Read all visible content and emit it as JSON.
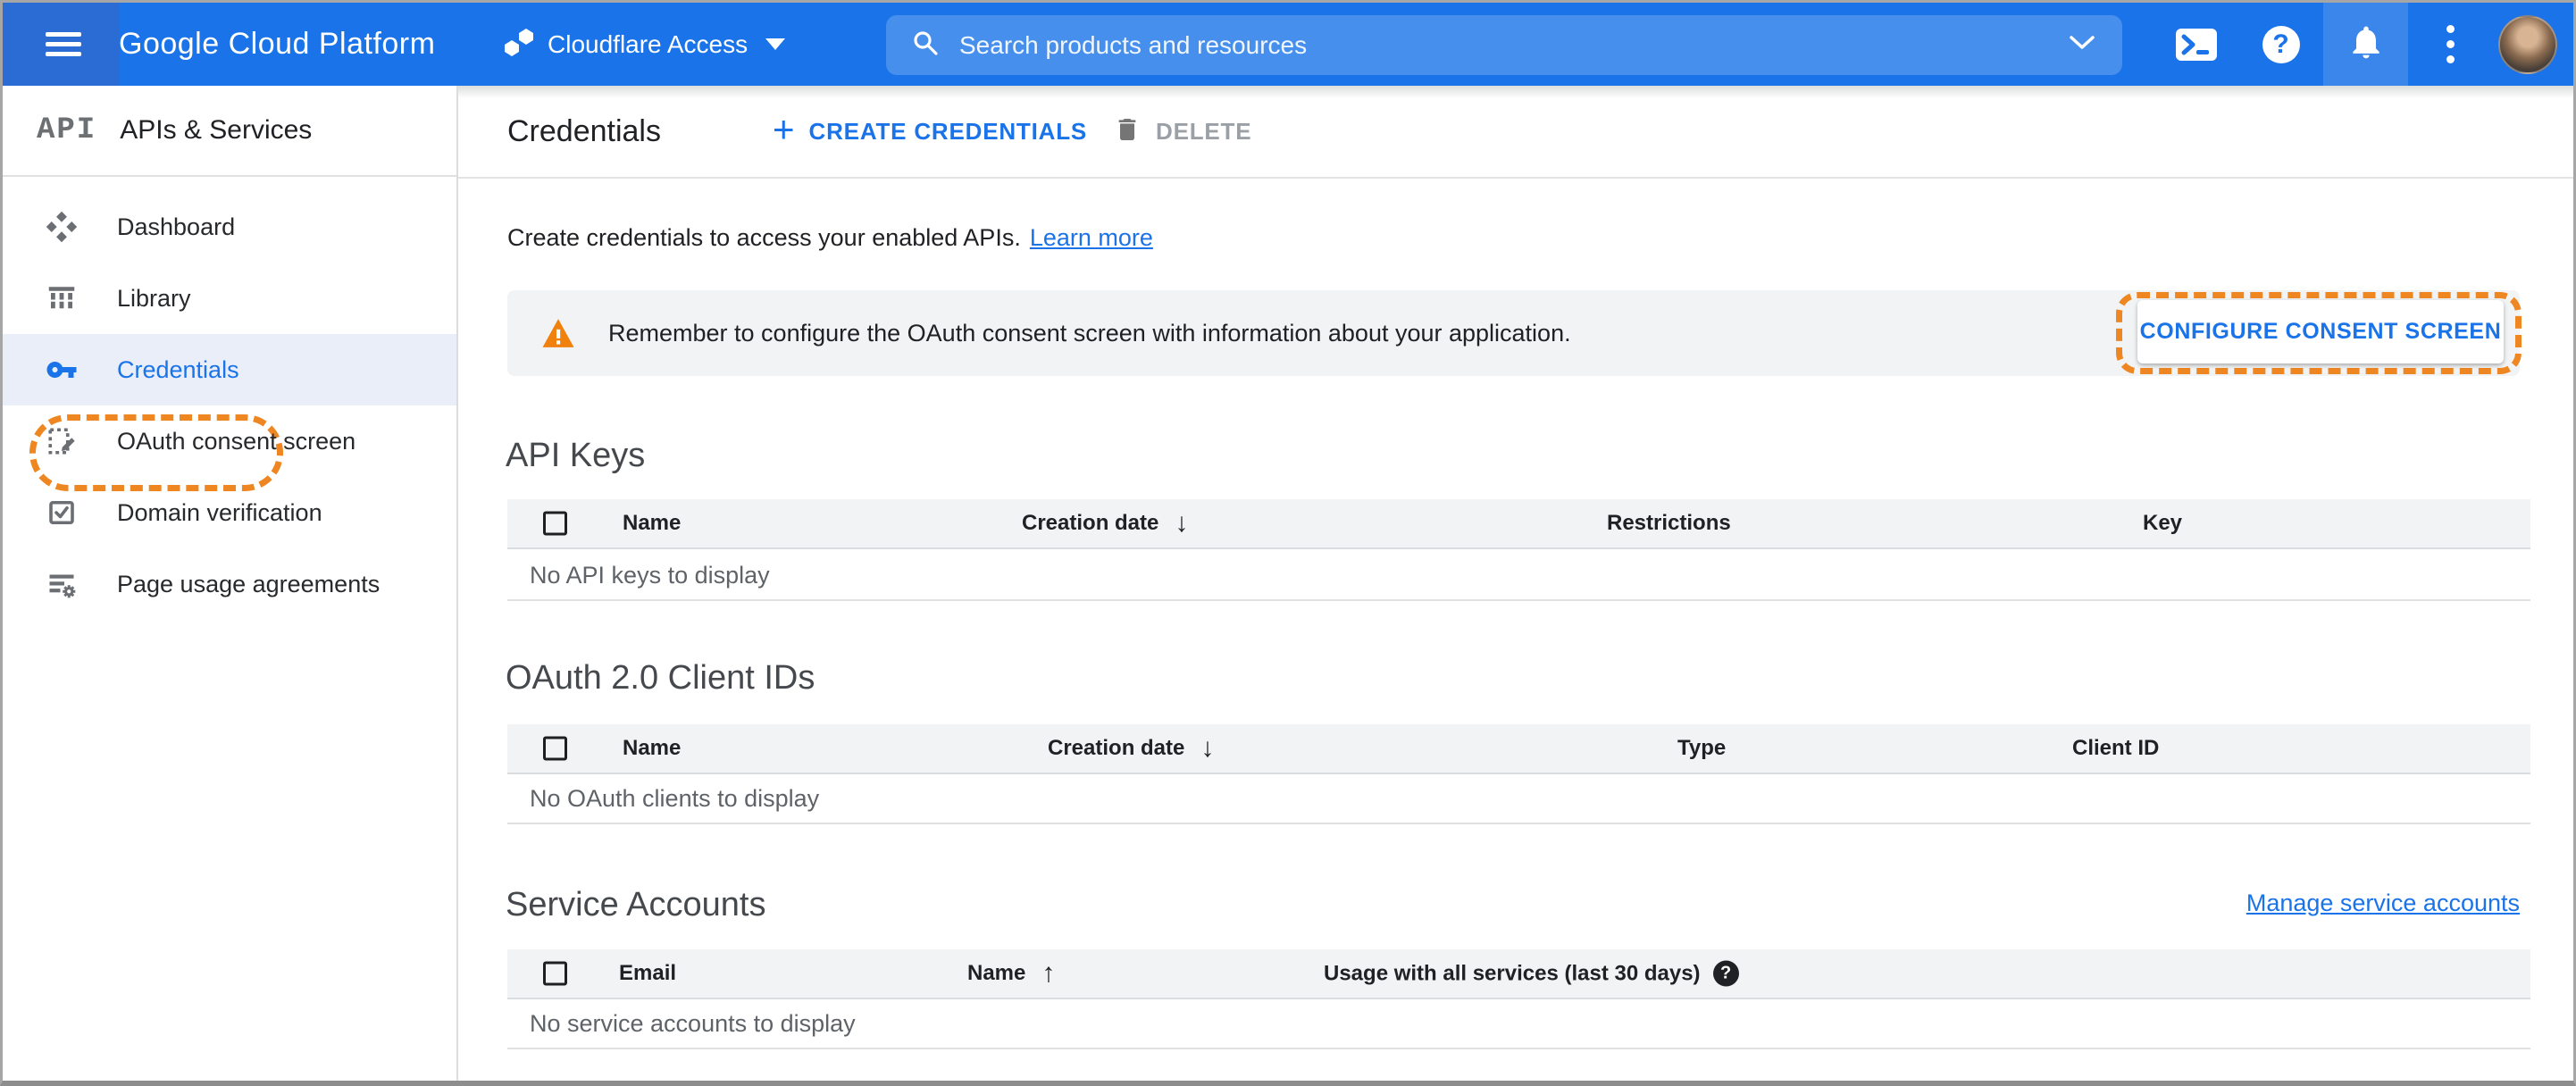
{
  "topbar": {
    "product": "Google Cloud Platform",
    "project": {
      "name": "Cloudflare Access"
    },
    "search": {
      "placeholder": "Search products and resources"
    }
  },
  "sidebar": {
    "logo": "API",
    "title": "APIs & Services",
    "items": [
      {
        "label": "Dashboard"
      },
      {
        "label": "Library"
      },
      {
        "label": "Credentials"
      },
      {
        "label": "OAuth consent screen"
      },
      {
        "label": "Domain verification"
      },
      {
        "label": "Page usage agreements"
      }
    ]
  },
  "toolbar": {
    "title": "Credentials",
    "plus": "+",
    "create_label": "CREATE CREDENTIALS",
    "delete_label": "DELETE"
  },
  "intro": {
    "text": "Create credentials to access your enabled APIs.",
    "link": "Learn more"
  },
  "banner": {
    "message": "Remember to configure the OAuth consent screen with information about your application.",
    "button": "CONFIGURE CONSENT SCREEN"
  },
  "sections": {
    "api_keys": {
      "title": "API Keys",
      "columns": [
        "Name",
        "Creation date",
        "Restrictions",
        "Key"
      ],
      "empty": "No API keys to display"
    },
    "oauth_clients": {
      "title": "OAuth 2.0 Client IDs",
      "columns": [
        "Name",
        "Creation date",
        "Type",
        "Client ID"
      ],
      "empty": "No OAuth clients to display"
    },
    "service_accounts": {
      "title": "Service Accounts",
      "link": "Manage service accounts",
      "columns": [
        "Email",
        "Name",
        "Usage with all services (last 30 days)"
      ],
      "empty": "No service accounts to display"
    }
  },
  "icons": {
    "sort_desc": "↓",
    "sort_asc": "↑",
    "help": "?"
  },
  "colors": {
    "topbar_blue": "#1a73e8",
    "accent_blue": "#1a73e8",
    "annotation_orange": "#ee8622",
    "warning_orange": "#f0810f",
    "band_gray": "#f1f3f4"
  }
}
